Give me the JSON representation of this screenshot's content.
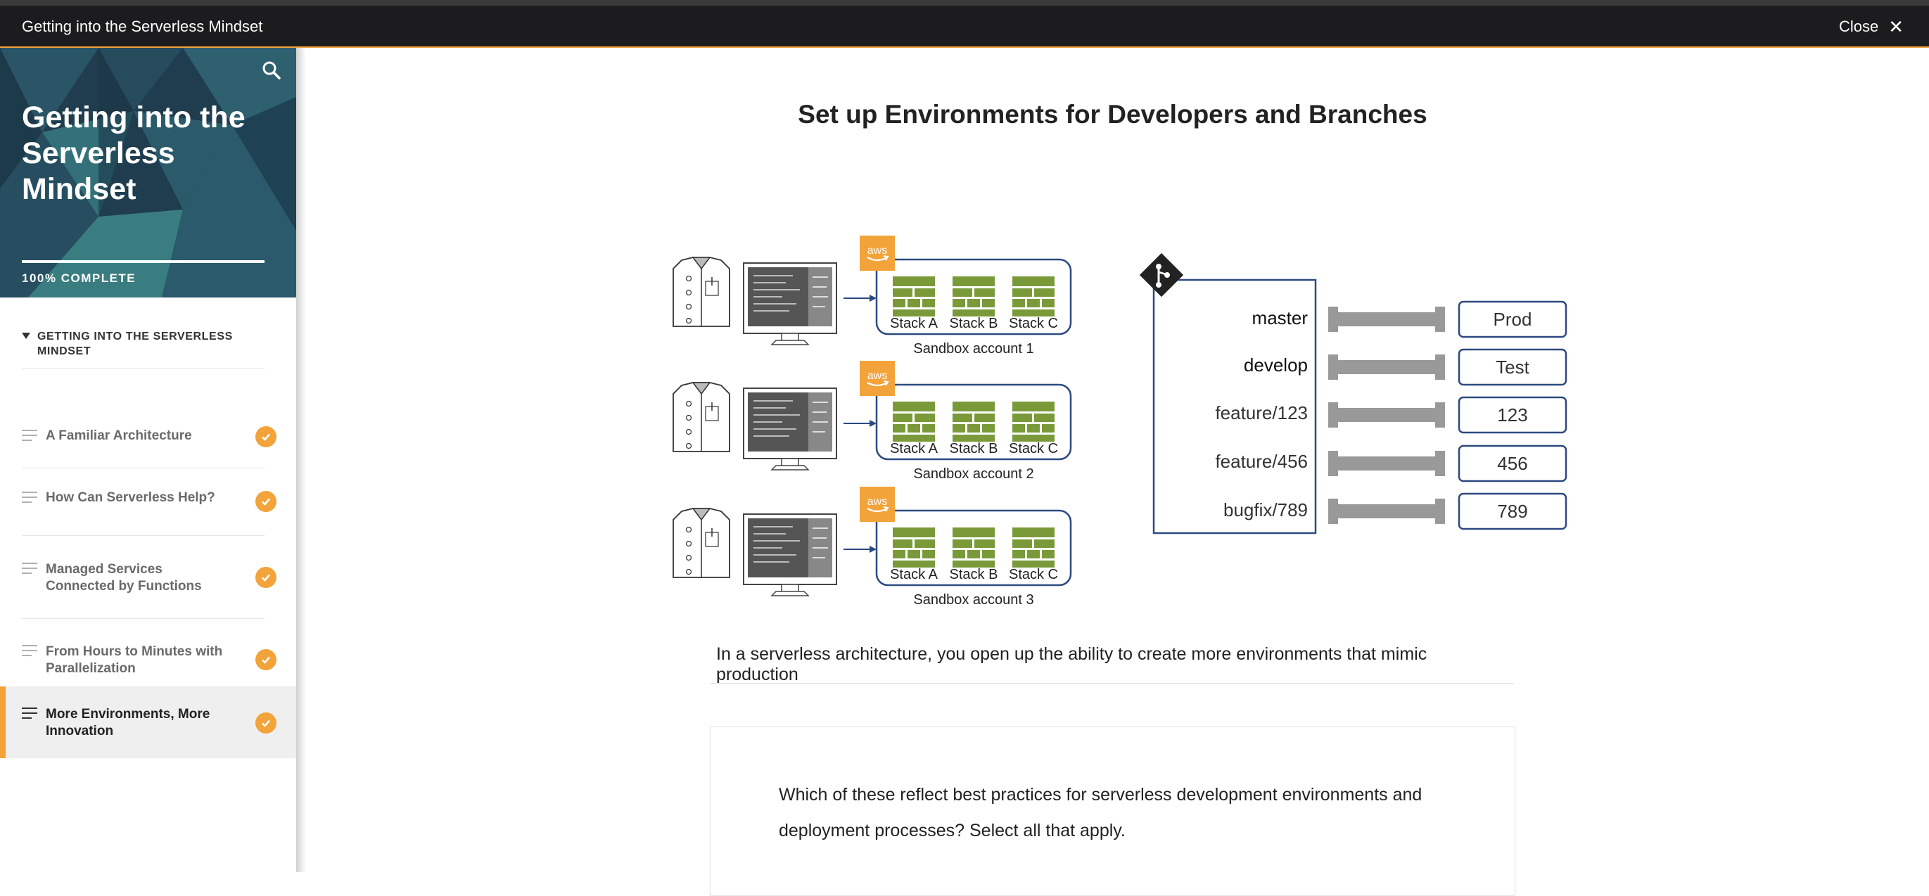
{
  "window": {
    "title": "Getting into the Serverless Mindset",
    "close_label": "Close"
  },
  "sidebar": {
    "course_title": "Getting into the Serverless Mindset",
    "progress_label": "100% COMPLETE",
    "progress": 1.0,
    "section_label": "GETTING INTO THE SERVERLESS MINDSET",
    "lessons": [
      {
        "label": "A Familiar Architecture",
        "complete": true
      },
      {
        "label": "How Can Serverless Help?",
        "complete": true
      },
      {
        "label": "Managed Services Connected by Functions",
        "complete": true
      },
      {
        "label": "From Hours to Minutes with Parallelization",
        "complete": true
      },
      {
        "label": "More Environments, More Innovation",
        "complete": true,
        "active": true
      }
    ]
  },
  "main": {
    "heading": "Set up Environments for Developers and Branches",
    "diagram": {
      "aws_label": "aws",
      "accounts": [
        {
          "name": "Sandbox account 1",
          "stacks": [
            "Stack A",
            "Stack B",
            "Stack C"
          ]
        },
        {
          "name": "Sandbox account 2",
          "stacks": [
            "Stack A",
            "Stack B",
            "Stack C"
          ]
        },
        {
          "name": "Sandbox account 3",
          "stacks": [
            "Stack A",
            "Stack B",
            "Stack C"
          ]
        }
      ],
      "branches": [
        {
          "branch": "master",
          "env": "Prod"
        },
        {
          "branch": "develop",
          "env": "Test"
        },
        {
          "branch": "feature/123",
          "env": "123"
        },
        {
          "branch": "feature/456",
          "env": "456"
        },
        {
          "branch": "bugfix/789",
          "env": "789"
        }
      ]
    },
    "caption": "In a serverless architecture, you open up the ability to create more environments that mimic production",
    "question": "Which of these reflect best practices for serverless development environments and deployment processes? Select all that apply."
  },
  "colors": {
    "accent": "#f2a33a",
    "titlebar": "#1c1c1e",
    "stack_green": "#7a9a3a",
    "box_blue": "#2c4a80"
  }
}
